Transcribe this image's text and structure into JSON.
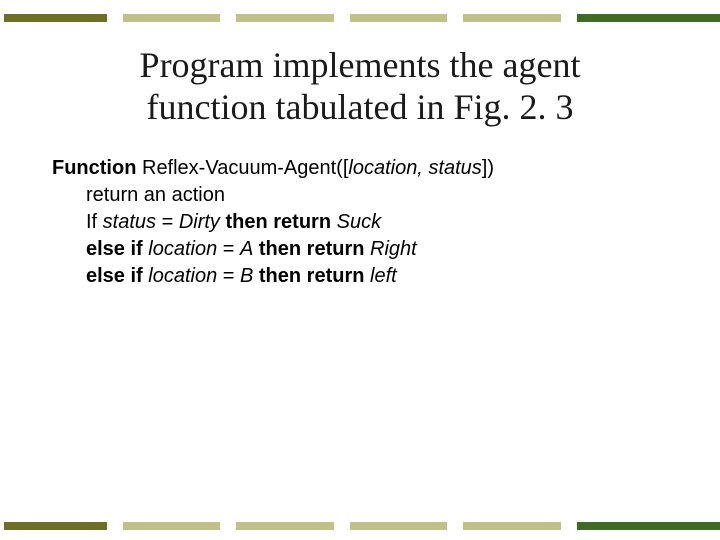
{
  "title_line1": "Program implements the agent",
  "title_line2": "function tabulated in Fig. 2. 3",
  "fn": {
    "kw_function": "Function",
    "fn_name": " Reflex-Vacuum-Agent([",
    "arg1": "location,",
    "arg_sp": " ",
    "arg2": "status",
    "close": "])",
    "ret_line": "return an action",
    "l1_if": "If ",
    "l1_var": "status",
    "l1_eq": " =  ",
    "l1_val": "Dirty",
    "l1_then": " then return ",
    "l1_act": "Suck",
    "l2_else": "else if ",
    "l2_var": "location",
    "l2_eq": " = ",
    "l2_val": "A",
    "l2_then": " then return ",
    "l2_act": "Right",
    "l3_else": "else if ",
    "l3_var": "location",
    "l3_eq": " = ",
    "l3_val": "B",
    "l3_then": " then return ",
    "l3_act": "left"
  }
}
